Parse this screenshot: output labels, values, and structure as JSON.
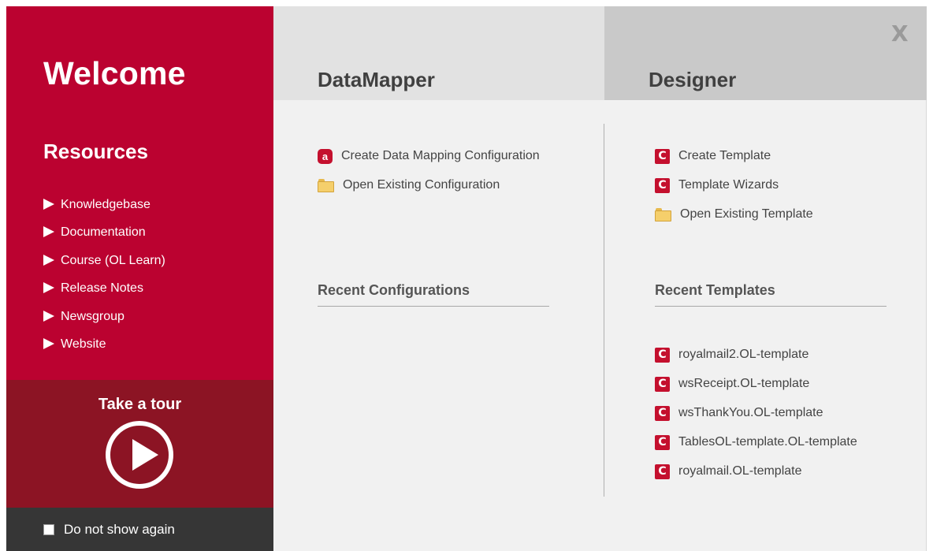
{
  "sidebar": {
    "welcome": "Welcome",
    "resources_title": "Resources",
    "resources": [
      "Knowledgebase",
      "Documentation",
      "Course (OL Learn)",
      "Release Notes",
      "Newsgroup",
      "Website"
    ],
    "tour_label": "Take a tour",
    "do_not_show": "Do not show again"
  },
  "close_label": "X",
  "datamapper": {
    "title": "DataMapper",
    "actions": [
      {
        "label": "Create Data Mapping Configuration",
        "icon": "datamapper-icon"
      },
      {
        "label": "Open Existing Configuration",
        "icon": "folder-icon"
      }
    ],
    "recent_title": "Recent Configurations",
    "recent": []
  },
  "designer": {
    "title": "Designer",
    "actions": [
      {
        "label": "Create Template",
        "icon": "designer-icon"
      },
      {
        "label": "Template Wizards",
        "icon": "designer-icon"
      },
      {
        "label": "Open Existing Template",
        "icon": "folder-icon"
      }
    ],
    "recent_title": "Recent Templates",
    "recent": [
      "royalmail2.OL-template",
      "wsReceipt.OL-template",
      "wsThankYou.OL-template",
      "TablesOL-template.OL-template",
      "royalmail.OL-template"
    ]
  },
  "icon_glyphs": {
    "designer": "C",
    "datamapper": "a"
  },
  "colors": {
    "brand_red": "#bb0230",
    "tour_dark_red": "#8c1424",
    "footer_dark": "#363636",
    "icon_red": "#c4102e"
  }
}
